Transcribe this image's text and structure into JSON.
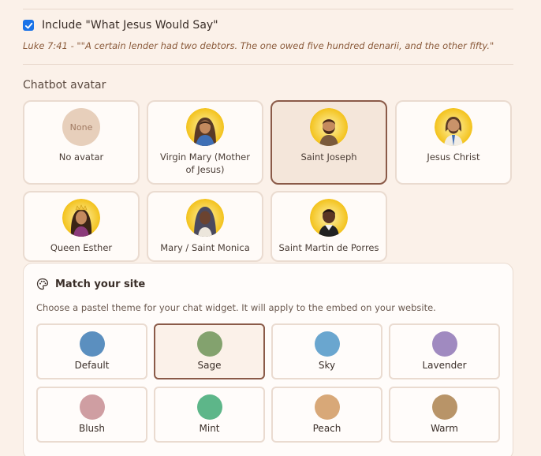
{
  "include_section": {
    "checked": true,
    "label": "Include \"What Jesus Would Say\"",
    "quote": "Luke 7:41 - \"\"A certain lender had two debtors. The one owed five hundred denarii, and the other fifty.\""
  },
  "avatar_section": {
    "heading": "Chatbot avatar",
    "none_text": "None",
    "avatars": [
      {
        "label": "No avatar",
        "selected": false
      },
      {
        "label": "Virgin Mary (Mother of Jesus)",
        "selected": false
      },
      {
        "label": "Saint Joseph",
        "selected": true
      },
      {
        "label": "Jesus Christ",
        "selected": false
      },
      {
        "label": "Queen Esther",
        "selected": false
      },
      {
        "label": "Mary / Saint Monica",
        "selected": false
      },
      {
        "label": "Saint Martin de Porres",
        "selected": false
      }
    ]
  },
  "theme_section": {
    "title": "Match your site",
    "icon": "palette-icon",
    "description": "Choose a pastel theme for your chat widget. It will apply to the embed on your website.",
    "themes": [
      {
        "label": "Default",
        "color": "#5b8fbf",
        "selected": false
      },
      {
        "label": "Sage",
        "color": "#83a26e",
        "selected": true
      },
      {
        "label": "Sky",
        "color": "#6aa6cf",
        "selected": false
      },
      {
        "label": "Lavender",
        "color": "#a08ac0",
        "selected": false
      },
      {
        "label": "Blush",
        "color": "#cf9ea2",
        "selected": false
      },
      {
        "label": "Mint",
        "color": "#5db689",
        "selected": false
      },
      {
        "label": "Peach",
        "color": "#d8a878",
        "selected": false
      },
      {
        "label": "Warm",
        "color": "#b89468",
        "selected": false
      }
    ]
  }
}
